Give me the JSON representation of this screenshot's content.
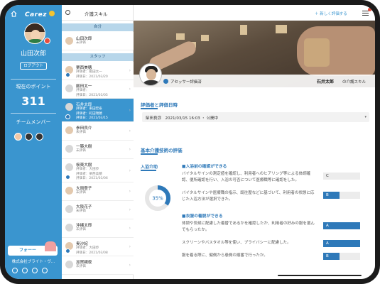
{
  "sidebar": {
    "logo": "Carez",
    "user_name": "山田次郎",
    "logout_label": "ログアウト",
    "points_label": "現在のポイント",
    "points_value": "311",
    "team_label": "チームメンバー",
    "follow_label": "フォーー",
    "company": "株式会社ブライト・ヴ…"
  },
  "list": {
    "title": "介護スキル",
    "section_self": "自分",
    "section_staff": "スタッフ",
    "self_item": {
      "name": "山田次郎",
      "status": "未評価"
    },
    "staff": [
      {
        "name": "栗西美穂",
        "line1": "評価者：飯田太一",
        "line2": "評価日：2021/03/20",
        "checked": true
      },
      {
        "name": "飯田太一",
        "line1": "評価者：",
        "line2": "評価日：2021/03/05",
        "checked": false
      },
      {
        "name": "石井太郎",
        "line1": "評価者：東田宏泰",
        "line2": "評価者：町田瑞穂",
        "line3": "評価日：2021/03/15",
        "checked": true,
        "selected": true
      },
      {
        "name": "参田良介",
        "line1": "未評価",
        "checked": false
      },
      {
        "name": "一築大樹",
        "line1": "未評価",
        "checked": false
      },
      {
        "name": "桜東大樹",
        "line1": "評価者：大田歩",
        "line2": "評価者：栗西美穂",
        "line3": "評価日：2021/03/06",
        "checked": true
      },
      {
        "name": "大岡登子",
        "line1": "未評価",
        "checked": false
      },
      {
        "name": "大阪花子",
        "line1": "未評価",
        "checked": false
      },
      {
        "name": "沖縄太郎",
        "line1": "未評価",
        "checked": false
      },
      {
        "name": "奥沙紀",
        "line1": "評価者：大田歩",
        "line2": "評価日：2021/03/08",
        "checked": true
      },
      {
        "name": "加賀親夜",
        "line1": "未評価",
        "checked": false
      }
    ]
  },
  "header": {
    "new_eval": "＋ 新しく評価する"
  },
  "hero": {
    "assessor_label": "アセッサー評価済",
    "target_name": "石井太郎",
    "target_suffix": "の介護スキル"
  },
  "eval": {
    "section_title": "評価者と評価日時",
    "evaluator_line": "柴田良弥　2021/03/15 16:03 ・ 公開中",
    "skill_title": "基本介護技術の評価",
    "category": "入浴介助",
    "percent_text": "35%",
    "percent": 35,
    "groups": [
      {
        "heading": "■入浴前の確認ができる",
        "items": [
          {
            "text": "バイタルサインの測定値を確認し、利用者へのヒアリング等による体調確認、便所確認を行い、入浴の可否について医療職等に確認をした。",
            "grade": "C",
            "fill": 0
          },
          {
            "text": "バイタルサインや医療職の指示、既往歴などに基づいて、利用者の状態に応じた入浴方法が選択できた。",
            "grade": "B",
            "fill": 0.45
          }
        ]
      },
      {
        "heading": "■衣服の着脱ができる",
        "items": [
          {
            "text": "体調や気候に配慮した着替であるかを確認したか、利用者の好みの服を選んでもらったか。",
            "grade": "A",
            "fill": 1
          },
          {
            "text": "スクリーンやバスタオル等を使い、プライバシーに配慮した。",
            "grade": "A",
            "fill": 1
          },
          {
            "text": "服を着る際に、健側から患側の順番で行ったか。",
            "grade": "B",
            "fill": 0.45
          }
        ]
      }
    ]
  },
  "colors": {
    "brand_blue": "#3a95cf",
    "accent_blue": "#2e79b9",
    "section_bg": "#b7d6ea"
  }
}
